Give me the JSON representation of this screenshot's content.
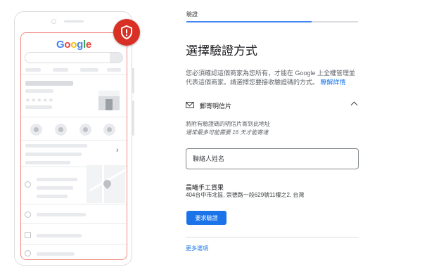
{
  "header": {
    "step_label": "驗證",
    "progress_fraction": 0.73
  },
  "main": {
    "title": "選擇驗證方式",
    "description": "您必須確認這個商家為您所有，才能在 Google 上全權管理並代表這個商家。請選擇您要接收驗證碼的方式。",
    "learn_more_label": "瞭解詳情"
  },
  "mail_option": {
    "icon": "mail-icon",
    "title": "郵寄明信片",
    "collapse_icon": "chevron-up-icon",
    "note_line1": "將附有驗證碼的明信片寄到此地址",
    "note_line2": "通常最多可能需要 16 天才能寄達",
    "contact_placeholder": "聯絡人姓名",
    "business_name": "晨曦手工貨果",
    "business_address": "404台中市北區, 崇德路一段629號11樓之2, 台灣",
    "request_button_label": "要求驗證"
  },
  "footer": {
    "more_options_label": "更多選項"
  },
  "illustration": {
    "logo_text": "Google",
    "badge_icon": "shield-alert-icon",
    "badge_color": "#d93025",
    "frame_color": "#f28b82"
  }
}
